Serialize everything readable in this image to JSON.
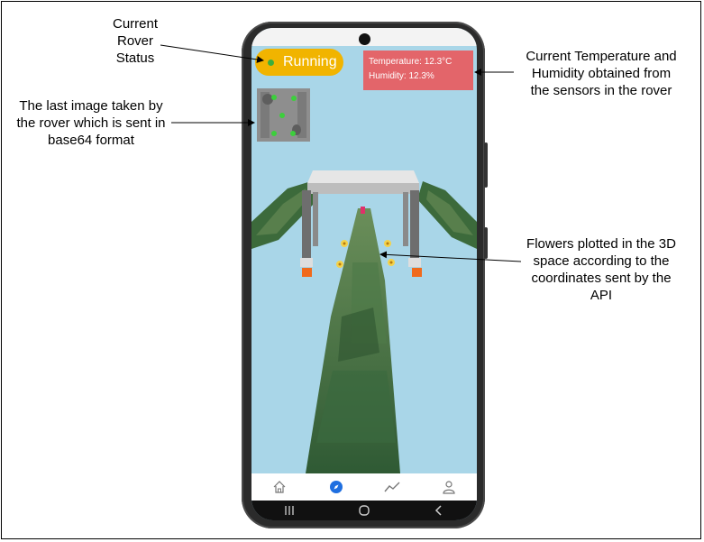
{
  "annotations": {
    "status_lines": [
      "Current",
      "Rover",
      "Status"
    ],
    "image_lines": [
      "The last image taken by",
      "the rover which is sent in",
      "base64 format"
    ],
    "sensor_lines": [
      "Current Temperature and",
      "Humidity obtained from",
      "the sensors in the rover"
    ],
    "flowers_lines": [
      "Flowers plotted in the 3D",
      "space according to the",
      "coordinates sent by the",
      "API"
    ]
  },
  "app": {
    "status_label": "Running",
    "status_color": "#f1b400",
    "status_dot_color": "#3cae3c",
    "temperature": "Temperature: 12.3°C",
    "humidity": "Humidity: 12.3%",
    "sensor_box_color": "#e3656a",
    "sky_color": "#a9d6e8"
  },
  "bottom_nav": [
    {
      "icon": "home-icon",
      "active": false
    },
    {
      "icon": "compass-icon",
      "active": true
    },
    {
      "icon": "trend-icon",
      "active": false
    },
    {
      "icon": "user-icon",
      "active": false
    }
  ],
  "system_nav": [
    "recent-apps-icon",
    "home-circle-icon",
    "back-icon"
  ],
  "accent_color": "#1f6fe0"
}
